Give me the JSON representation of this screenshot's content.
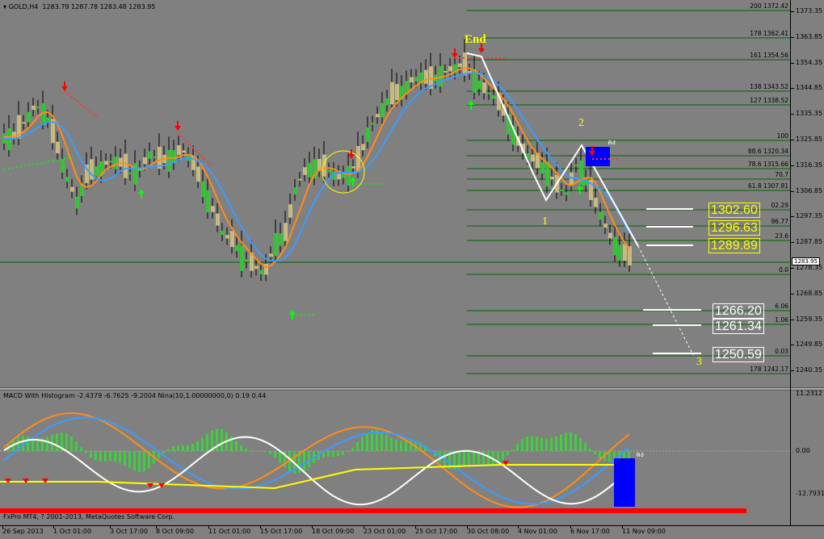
{
  "chart": {
    "symbol_title": "GOLD,H4",
    "ohlc": "1283.79 1287.78 1283.48 1283.95",
    "current_price": "1283.95",
    "end_label": "End",
    "wave_labels": [
      "1",
      "2",
      "3"
    ],
    "aj_label": "ลง"
  },
  "price_axis": [
    "1373.35",
    "1363.85",
    "1354.35",
    "1344.85",
    "1335.35",
    "1325.85",
    "1316.35",
    "1306.85",
    "1297.35",
    "1287.85",
    "1278.35",
    "1268.85",
    "1259.35",
    "1249.85",
    "1240.35"
  ],
  "fib_levels": [
    {
      "ratio": "200",
      "price": "1372.42"
    },
    {
      "ratio": "178",
      "price": "1362.41"
    },
    {
      "ratio": "161",
      "price": "1354.56"
    },
    {
      "ratio": "138",
      "price": "1343.52"
    },
    {
      "ratio": "127",
      "price": "1338.52"
    },
    {
      "ratio": "100",
      "price": ""
    },
    {
      "ratio": "88.6",
      "price": "1320.34"
    },
    {
      "ratio": "78.6",
      "price": "1315.66"
    },
    {
      "ratio": "70.7",
      "price": ""
    },
    {
      "ratio": "61.8",
      "price": "1307.81"
    },
    {
      "ratio": "",
      "price": "02.29"
    },
    {
      "ratio": "",
      "price": "96.77"
    },
    {
      "ratio": "23.6",
      "price": ""
    },
    {
      "ratio": "0.0",
      "price": ""
    },
    {
      "ratio": "",
      "price": "6.06"
    },
    {
      "ratio": "",
      "price": "1.06"
    },
    {
      "ratio": "",
      "price": "0.03"
    },
    {
      "ratio": "178",
      "price": "1242.17"
    }
  ],
  "targets": {
    "upper": [
      "1302.60",
      "1296.63",
      "1289.89"
    ],
    "lower": [
      "1266.20",
      "1261.34",
      "1250.59"
    ]
  },
  "macd": {
    "title": "MACD With Histogram -2.4379 -6.7625 -9.2004  Nina(10,1.00000000,0) 0.19 0.44",
    "axis": [
      "11.2312",
      "0.00",
      "-12.7931"
    ],
    "aj_label": "ลง"
  },
  "copyright": "FxPro MT4, ? 2001-2013, MetaQuotes Software Corp.",
  "time_axis": [
    "26 Sep 2013",
    "1 Oct 01:00",
    "3 Oct 17:00",
    "8 Oct 09:00",
    "11 Oct 01:00",
    "15 Oct 17:00",
    "18 Oct 09:00",
    "23 Oct 01:00",
    "25 Oct 17:00",
    "30 Oct 08:00",
    "4 Nov 01:00",
    "6 Nov 17:00",
    "11 Nov 09:00"
  ],
  "colors": {
    "background": "#808080",
    "bull_candle": "#32cd32",
    "bear_candle": "#d2c282",
    "ma_orange": "#ff8c1a",
    "ma_blue": "#3c9bff",
    "fib_line": "#006400",
    "signal_red": "#ff0000",
    "signal_green": "#00ff00",
    "target_yellow": "#ffff00"
  }
}
